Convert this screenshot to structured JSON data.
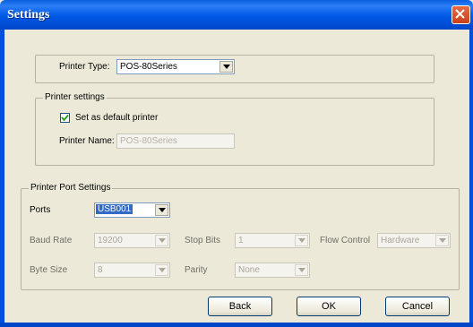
{
  "window": {
    "title": "Settings"
  },
  "printer_type": {
    "label": "Printer Type:",
    "value": "POS-80Series"
  },
  "printer_settings": {
    "group_title": "Printer settings",
    "default_checkbox_label": "Set as default printer",
    "default_checked": true,
    "name_label": "Printer Name:",
    "name_value": "POS-80Series"
  },
  "port_settings": {
    "group_title": "Printer Port Settings",
    "ports_label": "Ports",
    "ports_value": "USB001",
    "baud_label": "Baud Rate",
    "baud_value": "19200",
    "stop_label": "Stop Bits",
    "stop_value": "1",
    "flow_label": "Flow Control",
    "flow_value": "Hardware",
    "byte_label": "Byte Size",
    "byte_value": "8",
    "parity_label": "Parity",
    "parity_value": "None"
  },
  "buttons": {
    "back": "Back",
    "ok": "OK",
    "cancel": "Cancel"
  },
  "colors": {
    "titlebar": "#0058e6",
    "selection": "#316ac5",
    "dialog_bg": "#ece9d8"
  }
}
